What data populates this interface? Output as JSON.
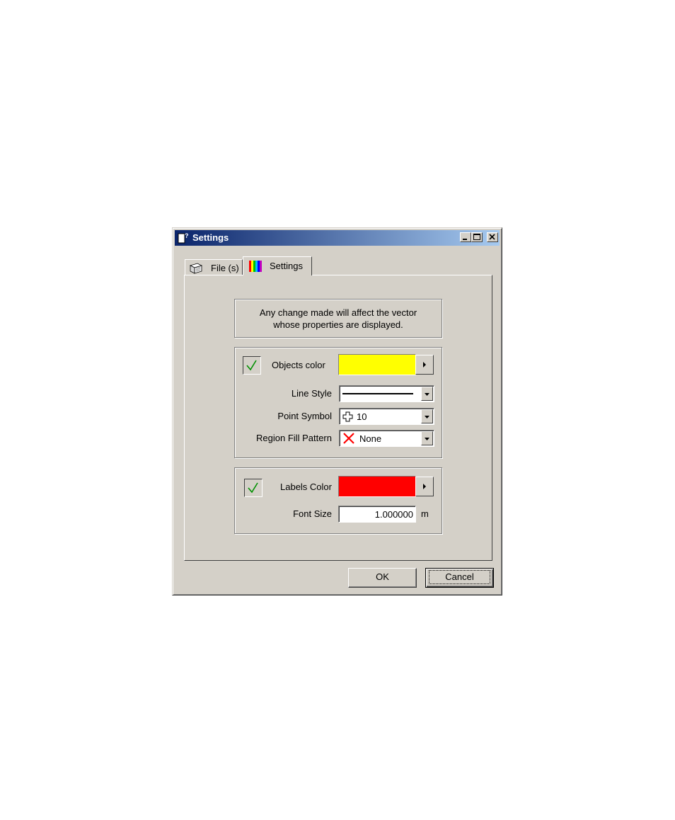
{
  "window": {
    "title": "Settings"
  },
  "tabs": [
    {
      "label": "File (s)",
      "icon": "files-icon"
    },
    {
      "label": "Settings",
      "icon": "color-bars-icon"
    }
  ],
  "info": {
    "line1": "Any change made will affect the vector",
    "line2": "whose properties are displayed."
  },
  "objects": {
    "enabled": true,
    "color_label": "Objects color",
    "color": "#ffff00",
    "line_style_label": "Line Style",
    "point_symbol_label": "Point Symbol",
    "point_symbol_value": "10",
    "region_fill_label": "Region Fill Pattern",
    "region_fill_value": "None"
  },
  "labels": {
    "enabled": true,
    "color_label": "Labels Color",
    "color": "#ff0000",
    "font_size_label": "Font Size",
    "font_size_value": "1.000000",
    "font_size_unit": "m"
  },
  "buttons": {
    "ok": "OK",
    "cancel": "Cancel"
  }
}
